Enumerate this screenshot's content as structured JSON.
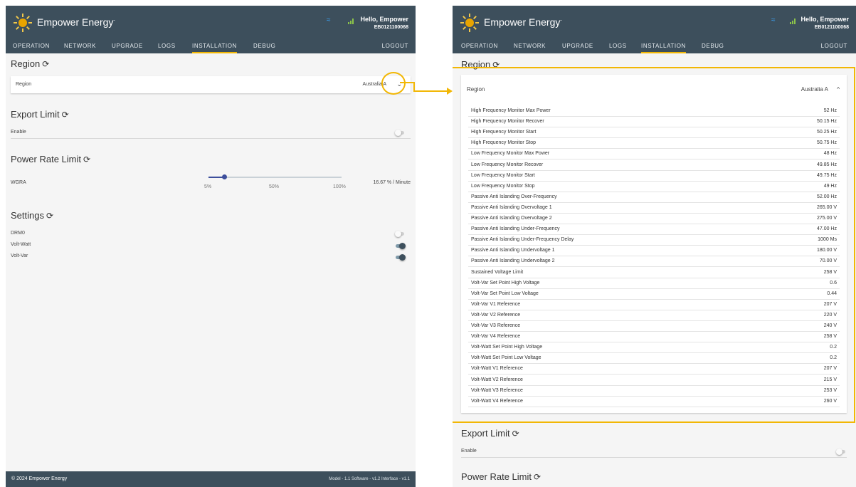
{
  "brand": {
    "name": "Empower Energy",
    "mark": "-"
  },
  "user": {
    "greeting": "Hello, Empower",
    "serial": "EB0121100068"
  },
  "nav": {
    "operation": "OPERATION",
    "network": "NETWORK",
    "upgrade": "UPGRADE",
    "logs": "LOGS",
    "installation": "INSTALLATION",
    "debug": "DEBUG",
    "logout": "LOGOUT"
  },
  "refresh_glyph": "⟳",
  "region": {
    "title": "Region",
    "label": "Region",
    "value_left": "Australia A",
    "value_right": "Australia A",
    "collapsed_icon": "⌄",
    "expanded_icon": "^"
  },
  "export_limit": {
    "title": "Export Limit",
    "enable_label": "Enable"
  },
  "power_rate": {
    "title": "Power Rate Limit",
    "wgra_label": "WGRA",
    "ticks": [
      "5%",
      "50%",
      "100%"
    ],
    "value": "16.67 % / Minute",
    "slider_fraction": 0.12
  },
  "settings": {
    "title": "Settings",
    "items": [
      {
        "label": "DRM0",
        "on": false
      },
      {
        "label": "Volt-Watt",
        "on": true
      },
      {
        "label": "Volt-Var",
        "on": true
      }
    ]
  },
  "footer": {
    "copyright": "© 2024 Empower Energy",
    "versions": "Model - 1.1   Software - v1.2   Interface - v1.1"
  },
  "region_params": [
    {
      "label": "High Frequency Monitor Max Power",
      "value": "52 Hz"
    },
    {
      "label": "High Frequency Monitor Recover",
      "value": "50.15 Hz"
    },
    {
      "label": "High Frequency Monitor Start",
      "value": "50.25 Hz"
    },
    {
      "label": "High Frequency Monitor Stop",
      "value": "50.75 Hz"
    },
    {
      "label": "Low Frequency Monitor Max Power",
      "value": "48 Hz"
    },
    {
      "label": "Low Frequency Monitor Recover",
      "value": "49.85 Hz"
    },
    {
      "label": "Low Frequency Monitor Start",
      "value": "49.75 Hz"
    },
    {
      "label": "Low Frequency Monitor Stop",
      "value": "49 Hz"
    },
    {
      "label": "Passive Anti Islanding Over-Frequency",
      "value": "52.00 Hz"
    },
    {
      "label": "Passive Anti Islanding Overvoltage 1",
      "value": "265.00 V"
    },
    {
      "label": "Passive Anti Islanding Overvoltage 2",
      "value": "275.00 V"
    },
    {
      "label": "Passive Anti Islanding Under-Frequency",
      "value": "47.00 Hz"
    },
    {
      "label": "Passive Anti Islanding Under-Frequency Delay",
      "value": "1000 Ms"
    },
    {
      "label": "Passive Anti Islanding Undervoltage 1",
      "value": "180.00 V"
    },
    {
      "label": "Passive Anti Islanding Undervoltage 2",
      "value": "70.00 V"
    },
    {
      "label": "Sustained Voltage Limit",
      "value": "258 V"
    },
    {
      "label": "Volt-Var Set Point High Voltage",
      "value": "0.6"
    },
    {
      "label": "Volt-Var Set Point Low Voltage",
      "value": "0.44"
    },
    {
      "label": "Volt-Var V1 Reference",
      "value": "207 V"
    },
    {
      "label": "Volt-Var V2 Reference",
      "value": "220 V"
    },
    {
      "label": "Volt-Var V3 Reference",
      "value": "240 V"
    },
    {
      "label": "Volt-Var V4 Reference",
      "value": "258 V"
    },
    {
      "label": "Volt-Watt Set Point High Voltage",
      "value": "0.2"
    },
    {
      "label": "Volt-Watt Set Point Low Voltage",
      "value": "0.2"
    },
    {
      "label": "Volt-Watt V1 Reference",
      "value": "207 V"
    },
    {
      "label": "Volt-Watt V2 Reference",
      "value": "215 V"
    },
    {
      "label": "Volt-Watt V3 Reference",
      "value": "253 V"
    },
    {
      "label": "Volt-Watt V4 Reference",
      "value": "260 V"
    }
  ],
  "colors": {
    "header_bg": "#3d4f5c",
    "page_bg": "#f5f5f5",
    "highlight": "#f2b705",
    "toggle_on": "#3d4f5c",
    "wifi": "#3aa7ff",
    "signal": "#8bc34a"
  }
}
